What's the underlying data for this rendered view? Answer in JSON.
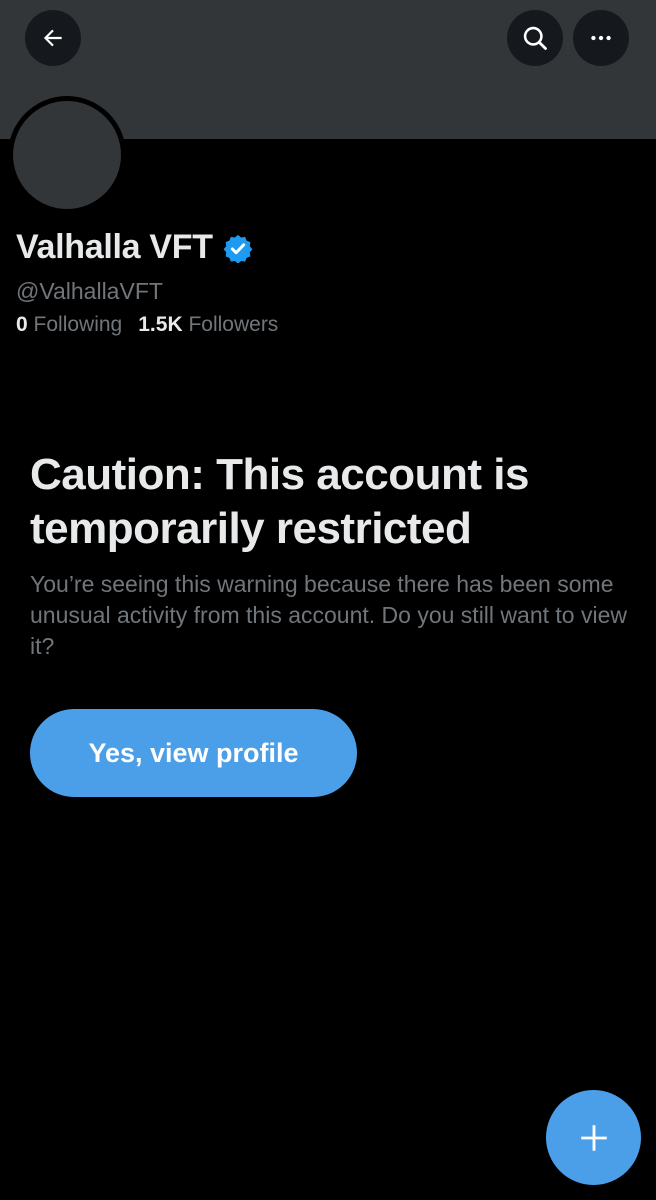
{
  "profile": {
    "display_name": "Valhalla VFT",
    "handle": "@ValhallaVFT",
    "verified": true,
    "following_count": "0",
    "following_label": "Following",
    "followers_count": "1.5K",
    "followers_label": "Followers"
  },
  "header": {
    "back_icon": "arrow-left-icon",
    "search_icon": "search-icon",
    "more_icon": "more-horizontal-icon"
  },
  "warning": {
    "title": "Caution: This account is temporarily restricted",
    "body": "You’re seeing this warning because there has been some unusual activity from this account. Do you still want to view it?",
    "button_label": "Yes, view profile"
  },
  "fab": {
    "icon": "plus-icon"
  },
  "colors": {
    "background": "#000000",
    "banner": "#333639",
    "primary_text": "#e7e9ea",
    "secondary_text": "#71767b",
    "accent": "#4b9fe8",
    "verified_badge": "#1d9bf0"
  }
}
